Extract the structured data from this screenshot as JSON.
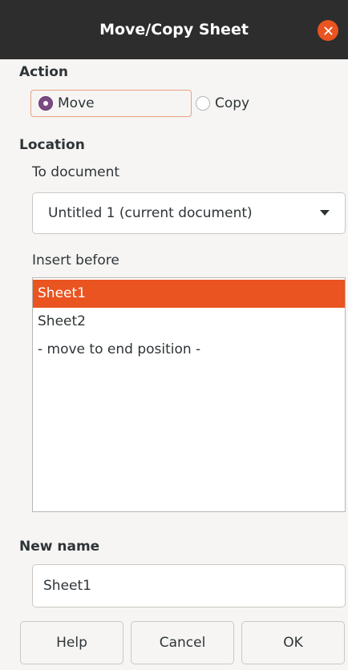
{
  "window": {
    "title": "Move/Copy Sheet",
    "accent": "#e95420"
  },
  "action": {
    "heading": "Action",
    "options": [
      {
        "label": "Move",
        "selected": true
      },
      {
        "label": "Copy",
        "selected": false
      }
    ]
  },
  "location": {
    "heading": "Location",
    "to_document_label": "To document",
    "to_document_value": "Untitled 1 (current document)",
    "insert_before_label": "Insert before",
    "items": [
      {
        "label": "Sheet1",
        "selected": true
      },
      {
        "label": "Sheet2",
        "selected": false
      },
      {
        "label": "- move to end position -",
        "selected": false
      }
    ]
  },
  "new_name": {
    "heading": "New name",
    "value": "Sheet1"
  },
  "buttons": {
    "help": "Help",
    "cancel": "Cancel",
    "ok": "OK"
  }
}
